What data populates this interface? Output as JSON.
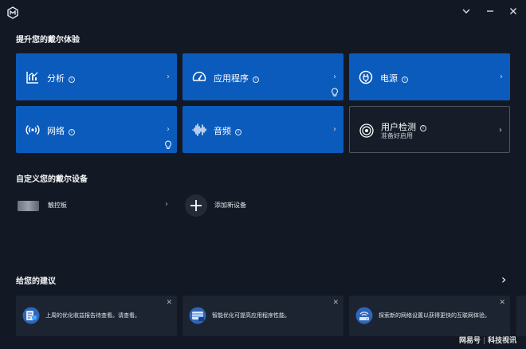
{
  "window": {
    "minimize_glyph": "‹",
    "close_glyph": "✕"
  },
  "experience": {
    "title": "提升您的戴尔体验",
    "tiles": [
      {
        "label": "分析",
        "icon": "chart-icon",
        "info": "i",
        "has_bulb": false
      },
      {
        "label": "应用程序",
        "icon": "gauge-icon",
        "info": "i",
        "has_bulb": true
      },
      {
        "label": "电源",
        "icon": "power-plug-icon",
        "info": "i",
        "has_bulb": false
      },
      {
        "label": "网络",
        "icon": "wifi-icon",
        "info": "i",
        "has_bulb": true
      },
      {
        "label": "音频",
        "icon": "audio-wave-icon",
        "info": "i",
        "has_bulb": false
      },
      {
        "label": "用户检测",
        "sublabel": "准备好启用",
        "icon": "presence-detection-icon",
        "info": "i",
        "has_bulb": false
      }
    ],
    "chevron": "›"
  },
  "devices": {
    "title": "自定义您的戴尔设备",
    "items": [
      {
        "label": "触控板"
      },
      {
        "label": "添加新设备"
      }
    ]
  },
  "suggestions": {
    "title": "给您的建议",
    "arrow": "›",
    "items": [
      {
        "text": "上周的优化收益报告待查看。请查看。",
        "close": "✕"
      },
      {
        "text": "智能优化可提高应用程序性能。",
        "close": "✕"
      },
      {
        "text": "探索新的网络设置以获得更快的互联网体验。",
        "close": "✕"
      }
    ]
  },
  "watermark": {
    "left": "网易号",
    "right": "科技视讯"
  },
  "colors": {
    "background": "#131924",
    "tile_blue": "#0b5bbd",
    "card": "#1c2431"
  }
}
